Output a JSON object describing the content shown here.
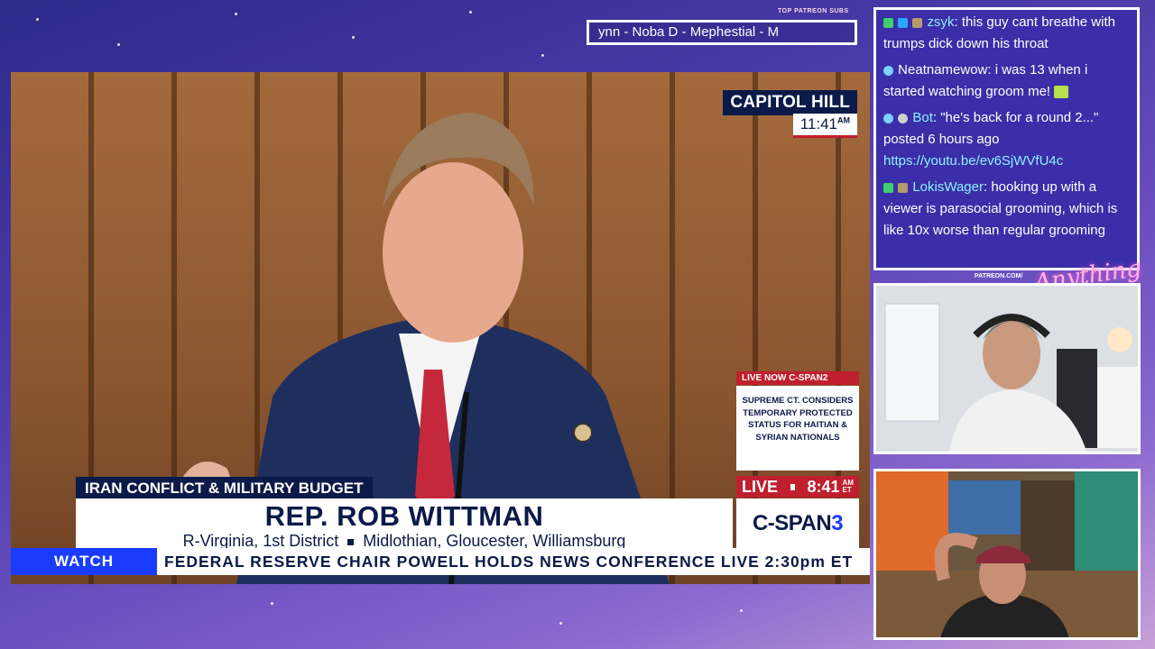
{
  "patreon_subs": {
    "label": "TOP PATREON SUBS",
    "names": "ynn -  Noba D - Mephestial - M"
  },
  "broadcast": {
    "location": "CAPITOL HILL",
    "local_time": "11:41",
    "local_time_suffix": "AM",
    "livenow_header": "LIVE NOW C-SPAN2",
    "livenow_body": "SUPREME CT. CONSIDERS TEMPORARY PROTECTED STATUS FOR HAITIAN & SYRIAN NATIONALS",
    "topic": "IRAN CONFLICT & MILITARY BUDGET",
    "speaker_name": "REP. ROB WITTMAN",
    "speaker_district": "R-Virginia, 1st District",
    "speaker_area": "Midlothian, Gloucester, Williamsburg",
    "live_label": "LIVE",
    "live_time": "8:41",
    "live_am": "AM",
    "live_et": "ET",
    "network": "C-SPAN",
    "network_number": "3",
    "ticker_label": "WATCH",
    "ticker_text": "FEDERAL RESERVE CHAIR POWELL HOLDS NEWS CONFERENCE  LIVE 2:30pm ET"
  },
  "chat": {
    "messages": [
      {
        "user": "zsyk",
        "text": ": this guy cant breathe with trumps dick down his throat",
        "user_color": "#8ef0ff"
      },
      {
        "user": "Neatnamewow",
        "text": ": i was 13 when i started watching groom me! ",
        "user_color": "#ffffff"
      },
      {
        "user": "Bot",
        "text": ": \"he's back for a round 2...\" posted 6 hours ago ",
        "link": "https://youtu.be/ev6SjWVfU4c",
        "user_color": "#8ef0ff"
      },
      {
        "user": "LokisWager",
        "text": ": hooking up with a viewer is parasocial grooming, which is like 10x worse than regular grooming",
        "user_color": "#8ef0ff"
      }
    ]
  },
  "overlay": {
    "patreon_url": "PATREON.COM/",
    "brand": "Anything Else?"
  }
}
